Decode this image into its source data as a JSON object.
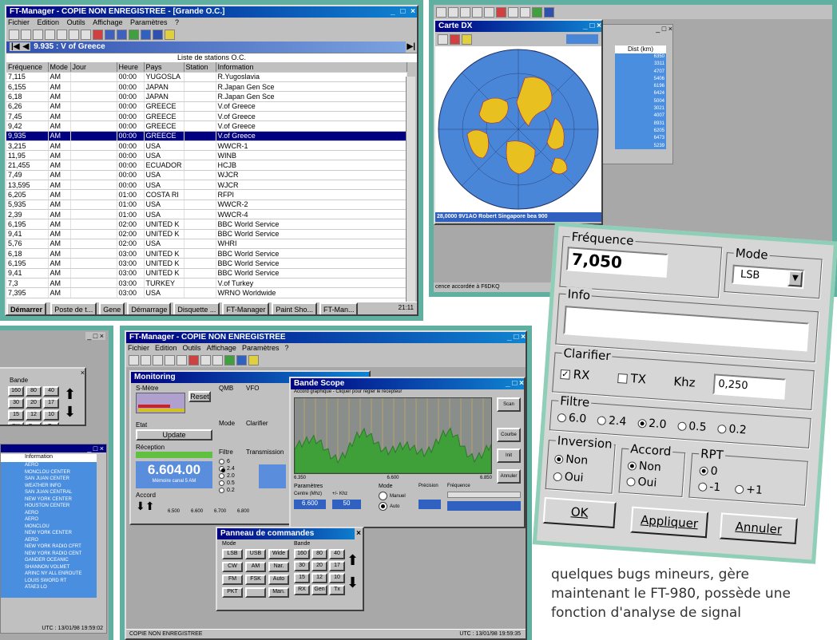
{
  "main_window": {
    "title": "FT-Manager - COPIE NON ENREGISTREE - [Grande O.C.]",
    "menu": [
      "Fichier",
      "Edition",
      "Outils",
      "Affichage",
      "Paramètres",
      "?"
    ],
    "nav_title": "9.935 : V of Greece",
    "list_caption": "Liste de stations O.C.",
    "columns": [
      "Fréquence",
      "Mode",
      "Jour",
      "Heure",
      "Pays",
      "Station",
      "Information"
    ],
    "rows": [
      [
        "7,115",
        "AM",
        "",
        "00:00",
        "YUGOSLA",
        "",
        "R.Yugoslavia"
      ],
      [
        "6,155",
        "AM",
        "",
        "00:00",
        "JAPAN",
        "",
        "R.Japan Gen Sce"
      ],
      [
        "6,18",
        "AM",
        "",
        "00:00",
        "JAPAN",
        "",
        "R.Japan Gen Sce"
      ],
      [
        "6,26",
        "AM",
        "",
        "00:00",
        "GREECE",
        "",
        "V.of Greece"
      ],
      [
        "7,45",
        "AM",
        "",
        "00:00",
        "GREECE",
        "",
        "V.of Greece"
      ],
      [
        "9,42",
        "AM",
        "",
        "00:00",
        "GREECE",
        "",
        "V.of Greece"
      ],
      [
        "9,935",
        "AM",
        "",
        "00:00",
        "GREECE",
        "",
        "V.of Greece"
      ],
      [
        "3,215",
        "AM",
        "",
        "00:00",
        "USA",
        "",
        "WWCR-1"
      ],
      [
        "11,95",
        "AM",
        "",
        "00:00",
        "USA",
        "",
        "WINB"
      ],
      [
        "21,455",
        "AM",
        "",
        "00:00",
        "ECUADOR",
        "",
        "HCJB"
      ],
      [
        "7,49",
        "AM",
        "",
        "00:00",
        "USA",
        "",
        "WJCR"
      ],
      [
        "13,595",
        "AM",
        "",
        "00:00",
        "USA",
        "",
        "WJCR"
      ],
      [
        "6,205",
        "AM",
        "",
        "01:00",
        "COSTA RI",
        "",
        "RFPI"
      ],
      [
        "5,935",
        "AM",
        "",
        "01:00",
        "USA",
        "",
        "WWCR-2"
      ],
      [
        "2,39",
        "AM",
        "",
        "01:00",
        "USA",
        "",
        "WWCR-4"
      ],
      [
        "6,195",
        "AM",
        "",
        "02:00",
        "UNITED K",
        "",
        "BBC World Service"
      ],
      [
        "9,41",
        "AM",
        "",
        "02:00",
        "UNITED K",
        "",
        "BBC World Service"
      ],
      [
        "5,76",
        "AM",
        "",
        "02:00",
        "USA",
        "",
        "WHRI"
      ],
      [
        "6,18",
        "AM",
        "",
        "03:00",
        "UNITED K",
        "",
        "BBC World Service"
      ],
      [
        "6,195",
        "AM",
        "",
        "03:00",
        "UNITED K",
        "",
        "BBC World Service"
      ],
      [
        "9,41",
        "AM",
        "",
        "03:00",
        "UNITED K",
        "",
        "BBC World Service"
      ],
      [
        "7,3",
        "AM",
        "",
        "03:00",
        "TURKEY",
        "",
        "V.of Turkey"
      ],
      [
        "7,395",
        "AM",
        "",
        "03:00",
        "USA",
        "",
        "WRNO Worldwide"
      ]
    ],
    "selected_row": 6,
    "taskbar": {
      "start": "Démarrer",
      "items": [
        "Poste de t...",
        "Gene",
        "Démarrage",
        "Disquette ...",
        "FT-Manager",
        "Paint Sho...",
        "FT-Man..."
      ],
      "clock": "21:11"
    }
  },
  "map_window": {
    "title": "Carte DX",
    "status": "28,0000 9V1AO Robert Singapore bea 900",
    "side_header": "Dist (km)",
    "distances": [
      "6350",
      "3311",
      "4707",
      "5406",
      "6196",
      "6424",
      "5004",
      "3021",
      "4007",
      "8931",
      "6205",
      "6473",
      "5239"
    ],
    "footer": "cence accordée à F6DKQ"
  },
  "bandscope": {
    "title": "FT-Manager - COPIE NON ENREGISTREE",
    "menu": [
      "Fichier",
      "Edition",
      "Outils",
      "Affichage",
      "Paramètres",
      "?"
    ],
    "monitoring": "Monitoring",
    "smetre": "S-Mètre",
    "reset": "Reset",
    "etat": "Etat",
    "update": "Update",
    "reception": "Réception",
    "freq": "6.604.00",
    "freq_sub": "Mémoire canal 5 AM",
    "accord": "Accord",
    "vfo": "VFO",
    "qmb": "QMB",
    "mode": "Mode",
    "clarifier": "Clarifier",
    "filtre": "Filtre",
    "transmission": "Transmission",
    "filters": [
      "6",
      "2.4",
      "2.0",
      "0.5",
      "0.2"
    ],
    "scope_title": "Bande Scope",
    "scope_hint": "Accord graphique - Cliquer pour régler le récepteur",
    "scale": [
      "6.350",
      "6.600",
      "6.850"
    ],
    "scope_buttons": [
      "Scan",
      "Courbe",
      "Init",
      "Annuler"
    ],
    "params": "Paramètres",
    "centre": "Centre (Mhz)",
    "centre_val": "6.600",
    "pm": "+/- Khz",
    "pm_val": "50",
    "mode_lbl": "Mode",
    "manuel": "Manuel",
    "auto": "Auto",
    "precision": "Précision",
    "frequence": "Fréquence",
    "accord_scale": [
      "6.500",
      "6.600",
      "6.700",
      "6.800"
    ],
    "cmd_title": "Panneau de commandes",
    "cmd_mode": "Mode",
    "cmd_bande": "Bande",
    "cmd_modes": [
      "LSB",
      "USB",
      "Wide",
      "CW",
      "AM",
      "Nar.",
      "FM",
      "FSK",
      "Auto",
      "PKT",
      "",
      "Man."
    ],
    "bands": [
      "160",
      "80",
      "40",
      "30",
      "20",
      "17",
      "15",
      "12",
      "10",
      "RX",
      "Gen",
      "Tx"
    ],
    "status_left": "COPIE NON ENREGISTREE",
    "status_right": "UTC : 13/01/98 19:59:35"
  },
  "left_window": {
    "bande": "Bande",
    "bands": [
      "160",
      "80",
      "40",
      "30",
      "20",
      "17",
      "15",
      "12",
      "10",
      "RX",
      "Gen",
      "Tx"
    ],
    "info_header": "Information",
    "items": [
      "AERO",
      "MONCLOU CENTER",
      "SAN JUAN CENTER",
      "WEATHER INFO",
      "SAN JUAN CENTRAL",
      "NEW YORK CENTER",
      "HOUSTON CENTER",
      "AERO",
      "AERO",
      "MONCLOU",
      "NEW YORK CENTER",
      "AERO",
      "NEW YORK RADIO CFRT",
      "NEW YORK RADIO CENT",
      "GANDER OCEANIC",
      "SHANNON VOLMET",
      "ARINC NY ALL ENROUTE",
      "LOUIS SWORD RT",
      "ATAE3 LO"
    ],
    "status": "UTC : 13/01/98 19:59:02"
  },
  "dialog": {
    "frequence_label": "Fréquence",
    "frequence": "7,050",
    "mode_label": "Mode",
    "mode": "LSB",
    "info_label": "Info",
    "info": "",
    "clarifier_label": "Clarifier",
    "rx": "RX",
    "tx": "TX",
    "khz": "Khz",
    "clarifier_val": "0,250",
    "filtre_label": "Filtre",
    "filters": [
      "6.0",
      "2.4",
      "2.0",
      "0.5",
      "0.2"
    ],
    "filter_selected": 2,
    "inversion_label": "Inversion",
    "non": "Non",
    "oui": "Oui",
    "accord_label": "Accord",
    "rpt_label": "RPT",
    "rpt": [
      "0",
      "-1",
      "+1"
    ],
    "ok": "OK",
    "appliquer": "Appliquer",
    "annuler": "Annuler"
  },
  "article": "quelques bugs mineurs, gère maintenant le FT-980, possède une fonction d'analyse de signal",
  "colors": {
    "titlebar": "#000080",
    "highlight": "#000080",
    "frame": "#5fb0a0",
    "map_ocean": "#4a86d8"
  }
}
